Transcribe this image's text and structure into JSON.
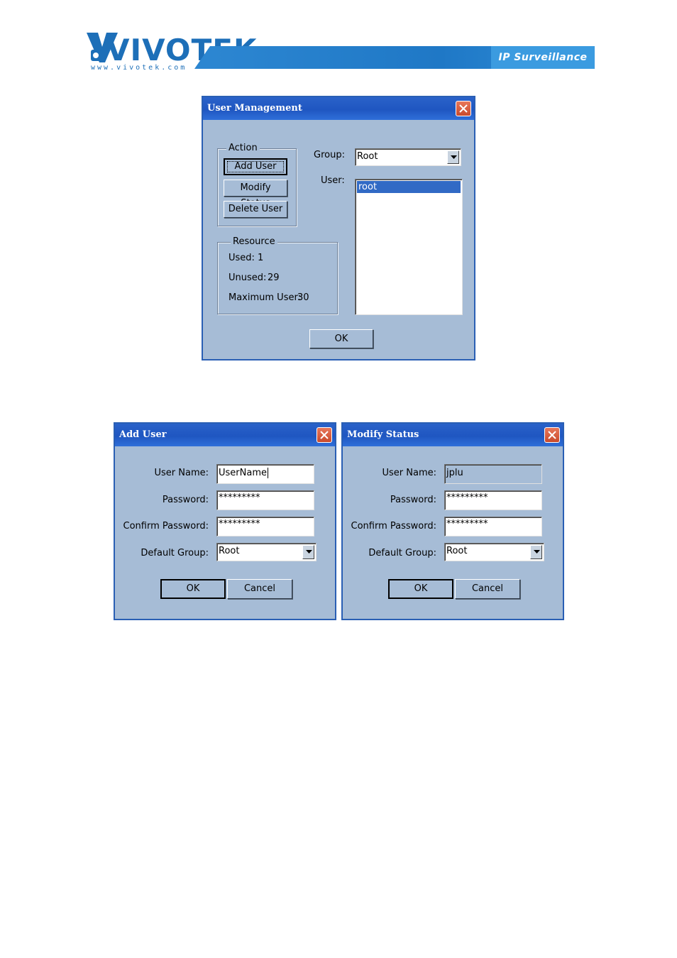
{
  "header": {
    "logo_text": "VIVOTEK",
    "logo_url": "www.vivotek.com",
    "tagline": "IP Surveillance",
    "brand_color": "#1d6fb8"
  },
  "user_management": {
    "title": "User Management",
    "action": {
      "caption": "Action",
      "add_user": "Add User",
      "modify_status": "Modify Status",
      "delete_user": "Delete User"
    },
    "group_label": "Group:",
    "group_value": "Root",
    "user_label": "User:",
    "users": [
      "root"
    ],
    "resource": {
      "caption": "Resource",
      "used_label": "Used:",
      "used_value": "1",
      "unused_label": "Unused:",
      "unused_value": "29",
      "max_label": "Maximum User:",
      "max_value": "30"
    },
    "ok": "OK"
  },
  "add_user": {
    "title": "Add User",
    "username_label": "User Name:",
    "username_value": "UserName",
    "password_label": "Password:",
    "password_value": "*********",
    "confirm_label": "Confirm Password:",
    "confirm_value": "*********",
    "group_label": "Default Group:",
    "group_value": "Root",
    "ok": "OK",
    "cancel": "Cancel"
  },
  "modify_status": {
    "title": "Modify Status",
    "username_label": "User Name:",
    "username_value": "jplu",
    "password_label": "Password:",
    "password_value": "*********",
    "confirm_label": "Confirm Password:",
    "confirm_value": "*********",
    "group_label": "Default Group:",
    "group_value": "Root",
    "ok": "OK",
    "cancel": "Cancel"
  }
}
